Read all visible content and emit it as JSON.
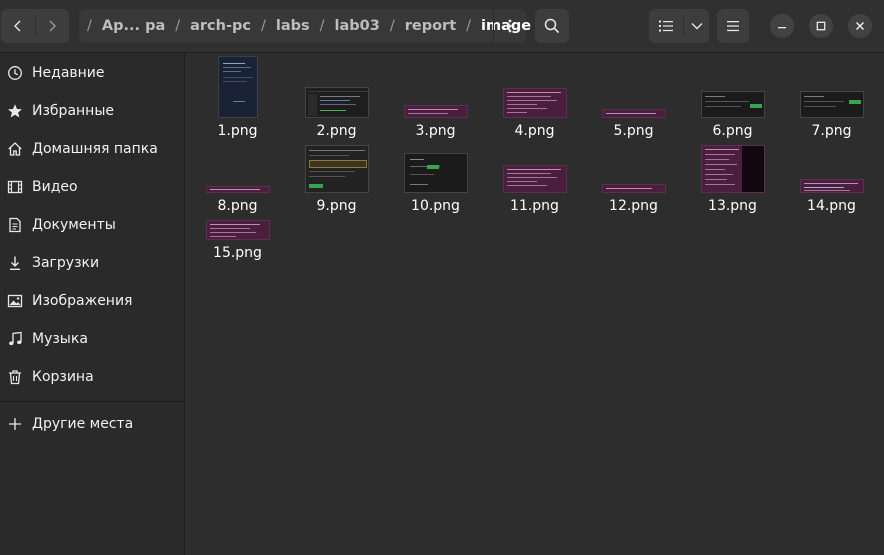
{
  "header": {
    "back_icon": "chevron-left-icon",
    "forward_icon": "chevron-right-icon",
    "path": [
      "Ар... ра",
      "arch-pc",
      "labs",
      "lab03",
      "report",
      "image"
    ],
    "separator": "/",
    "more_icon": "vertical-dots-icon",
    "search_icon": "search-icon",
    "list_view_icon": "list-view-icon",
    "view_options_icon": "chevron-down-icon",
    "menu_icon": "hamburger-menu-icon",
    "minimize_icon": "minimize-icon",
    "maximize_icon": "maximize-icon",
    "close_icon": "close-icon"
  },
  "sidebar": {
    "items": [
      {
        "label": "Недавние",
        "icon": "clock-icon"
      },
      {
        "label": "Избранные",
        "icon": "star-icon"
      },
      {
        "label": "Домашняя папка",
        "icon": "home-icon"
      },
      {
        "label": "Видео",
        "icon": "film-icon"
      },
      {
        "label": "Документы",
        "icon": "document-icon"
      },
      {
        "label": "Загрузки",
        "icon": "download-icon"
      },
      {
        "label": "Изображения",
        "icon": "image-icon"
      },
      {
        "label": "Музыка",
        "icon": "music-icon"
      },
      {
        "label": "Корзина",
        "icon": "trash-icon"
      }
    ],
    "other_places": {
      "label": "Другие места",
      "icon": "plus-icon"
    }
  },
  "files": [
    {
      "name": "1.png"
    },
    {
      "name": "2.png"
    },
    {
      "name": "3.png"
    },
    {
      "name": "4.png"
    },
    {
      "name": "5.png"
    },
    {
      "name": "6.png"
    },
    {
      "name": "7.png"
    },
    {
      "name": "8.png"
    },
    {
      "name": "9.png"
    },
    {
      "name": "10.png"
    },
    {
      "name": "11.png"
    },
    {
      "name": "12.png"
    },
    {
      "name": "13.png"
    },
    {
      "name": "14.png"
    },
    {
      "name": "15.png"
    }
  ],
  "colors": {
    "header_bg": "#303030",
    "sidebar_bg": "#2a2a2a",
    "main_bg": "#2d2d2d",
    "terminal_purple": "#4a1f3d",
    "dark_window": "#1b1b1b",
    "navy_doc": "#1a2236"
  }
}
